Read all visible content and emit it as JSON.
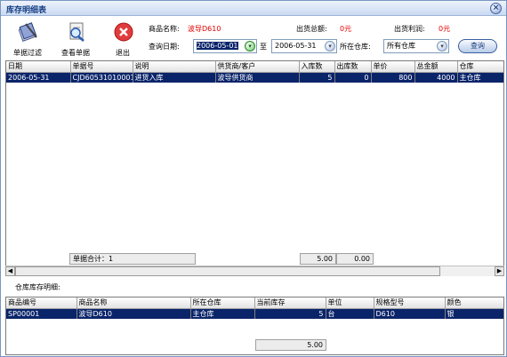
{
  "window": {
    "title": "库存明细表"
  },
  "toolbar": {
    "voucher_filter": "单据过滤",
    "view_voucher": "查看单据",
    "exit": "退出"
  },
  "filters": {
    "product_label": "商品名称:",
    "product_value": "波导D610",
    "out_total_label": "出货总额:",
    "out_total_value": "0元",
    "out_profit_label": "出货利润:",
    "out_profit_value": "0元",
    "date_label": "查询日期:",
    "date_from": "2006-05-01",
    "to_label": "至",
    "date_to": "2006-05-31",
    "warehouse_label": "所在仓库:",
    "warehouse_value": "所有仓库",
    "query_button": "查询"
  },
  "transactions": {
    "columns": [
      "日期",
      "单据号",
      "说明",
      "供货商/客户",
      "入库数",
      "出库数",
      "单价",
      "总金额",
      "仓库"
    ],
    "rows": [
      [
        "2006-05-31",
        "CJD60531010001",
        "进货入库",
        "波导供货商",
        "5",
        "0",
        "800",
        "4000",
        "主仓库"
      ]
    ],
    "footer": {
      "count_label": "单据合计：1",
      "in_total": "5.00",
      "out_total": "0.00"
    }
  },
  "stock": {
    "section_label": "仓库库存明细:",
    "columns": [
      "商品编号",
      "商品名称",
      "所在仓库",
      "当前库存",
      "单位",
      "规格型号",
      "颜色"
    ],
    "rows": [
      [
        "SP00001",
        "波导D610",
        "主仓库",
        "5",
        "台",
        "D610",
        "银"
      ]
    ],
    "footer_total": "5.00"
  },
  "colors": {
    "selection": "#0a246a",
    "title_text": "#153e84",
    "highlight_value": "#e00000"
  },
  "icons": {
    "filter": "pencil-notebook-icon",
    "view": "magnifier-document-icon",
    "exit": "red-x-icon",
    "close": "close-icon"
  }
}
